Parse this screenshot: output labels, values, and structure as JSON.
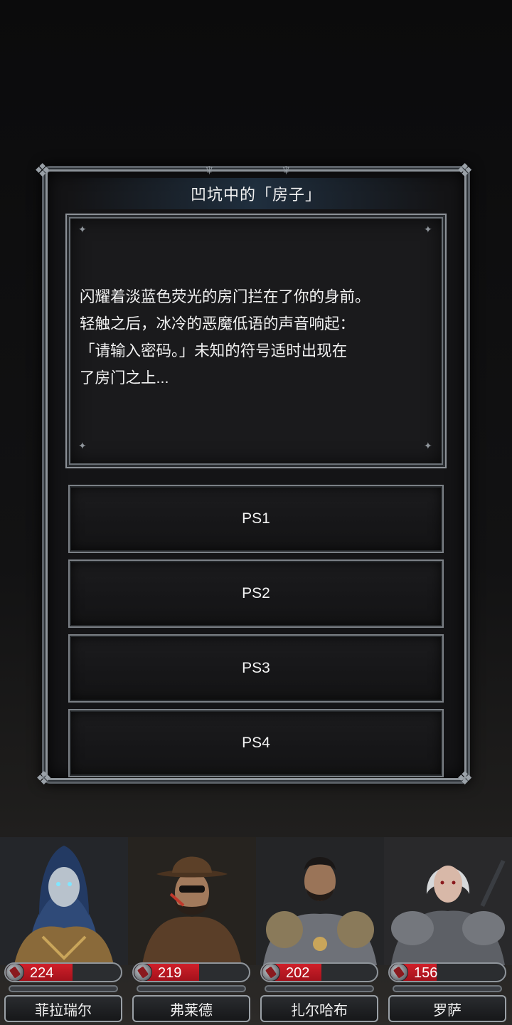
{
  "event": {
    "title": "凹坑中的「房子」",
    "story_lines": [
      "闪耀着淡蓝色荧光的房门拦在了你的身前。",
      "轻触之后，冰冷的恶魔低语的声音响起：",
      "「请输入密码。」未知的符号适时出现在",
      "了房门之上..."
    ]
  },
  "options": [
    {
      "label": "PS1"
    },
    {
      "label": "PS2"
    },
    {
      "label": "PS3"
    },
    {
      "label": "PS4"
    }
  ],
  "party": [
    {
      "name": "菲拉瑞尔",
      "hp": "224",
      "hp_fraction": 0.58,
      "portrait_icon": "hooded-sorceress-portrait",
      "theme_color": "#3a5b8c"
    },
    {
      "name": "弗莱德",
      "hp": "219",
      "hp_fraction": 0.57,
      "portrait_icon": "cowboy-gunslinger-portrait",
      "theme_color": "#6b4a2e"
    },
    {
      "name": "扎尔哈布",
      "hp": "202",
      "hp_fraction": 0.52,
      "portrait_icon": "bearded-warrior-portrait",
      "theme_color": "#5c5f66"
    },
    {
      "name": "罗萨",
      "hp": "156",
      "hp_fraction": 0.41,
      "portrait_icon": "armored-knight-woman-portrait",
      "theme_color": "#7d8085"
    }
  ],
  "colors": {
    "hp_red": "#c21a24",
    "frame_silver": "#8d9399",
    "panel_bg": "#141416"
  }
}
